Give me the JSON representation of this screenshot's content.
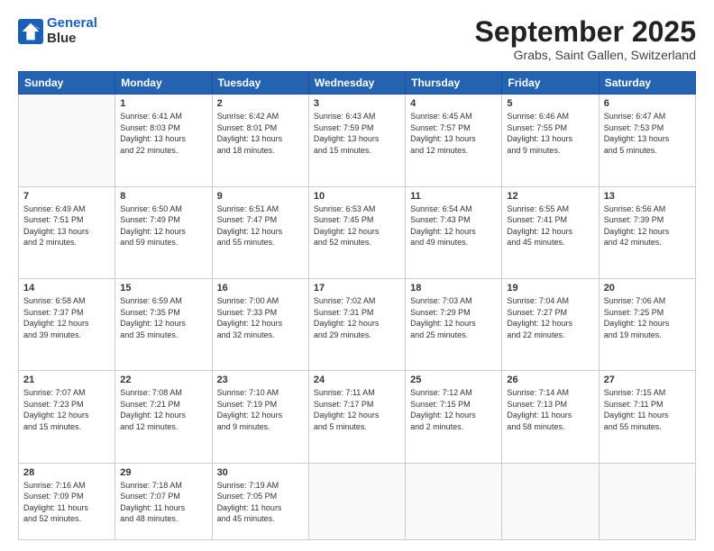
{
  "logo": {
    "line1": "General",
    "line2": "Blue"
  },
  "title": "September 2025",
  "location": "Grabs, Saint Gallen, Switzerland",
  "days_header": [
    "Sunday",
    "Monday",
    "Tuesday",
    "Wednesday",
    "Thursday",
    "Friday",
    "Saturday"
  ],
  "weeks": [
    [
      {
        "day": "",
        "content": ""
      },
      {
        "day": "1",
        "content": "Sunrise: 6:41 AM\nSunset: 8:03 PM\nDaylight: 13 hours\nand 22 minutes."
      },
      {
        "day": "2",
        "content": "Sunrise: 6:42 AM\nSunset: 8:01 PM\nDaylight: 13 hours\nand 18 minutes."
      },
      {
        "day": "3",
        "content": "Sunrise: 6:43 AM\nSunset: 7:59 PM\nDaylight: 13 hours\nand 15 minutes."
      },
      {
        "day": "4",
        "content": "Sunrise: 6:45 AM\nSunset: 7:57 PM\nDaylight: 13 hours\nand 12 minutes."
      },
      {
        "day": "5",
        "content": "Sunrise: 6:46 AM\nSunset: 7:55 PM\nDaylight: 13 hours\nand 9 minutes."
      },
      {
        "day": "6",
        "content": "Sunrise: 6:47 AM\nSunset: 7:53 PM\nDaylight: 13 hours\nand 5 minutes."
      }
    ],
    [
      {
        "day": "7",
        "content": "Sunrise: 6:49 AM\nSunset: 7:51 PM\nDaylight: 13 hours\nand 2 minutes."
      },
      {
        "day": "8",
        "content": "Sunrise: 6:50 AM\nSunset: 7:49 PM\nDaylight: 12 hours\nand 59 minutes."
      },
      {
        "day": "9",
        "content": "Sunrise: 6:51 AM\nSunset: 7:47 PM\nDaylight: 12 hours\nand 55 minutes."
      },
      {
        "day": "10",
        "content": "Sunrise: 6:53 AM\nSunset: 7:45 PM\nDaylight: 12 hours\nand 52 minutes."
      },
      {
        "day": "11",
        "content": "Sunrise: 6:54 AM\nSunset: 7:43 PM\nDaylight: 12 hours\nand 49 minutes."
      },
      {
        "day": "12",
        "content": "Sunrise: 6:55 AM\nSunset: 7:41 PM\nDaylight: 12 hours\nand 45 minutes."
      },
      {
        "day": "13",
        "content": "Sunrise: 6:56 AM\nSunset: 7:39 PM\nDaylight: 12 hours\nand 42 minutes."
      }
    ],
    [
      {
        "day": "14",
        "content": "Sunrise: 6:58 AM\nSunset: 7:37 PM\nDaylight: 12 hours\nand 39 minutes."
      },
      {
        "day": "15",
        "content": "Sunrise: 6:59 AM\nSunset: 7:35 PM\nDaylight: 12 hours\nand 35 minutes."
      },
      {
        "day": "16",
        "content": "Sunrise: 7:00 AM\nSunset: 7:33 PM\nDaylight: 12 hours\nand 32 minutes."
      },
      {
        "day": "17",
        "content": "Sunrise: 7:02 AM\nSunset: 7:31 PM\nDaylight: 12 hours\nand 29 minutes."
      },
      {
        "day": "18",
        "content": "Sunrise: 7:03 AM\nSunset: 7:29 PM\nDaylight: 12 hours\nand 25 minutes."
      },
      {
        "day": "19",
        "content": "Sunrise: 7:04 AM\nSunset: 7:27 PM\nDaylight: 12 hours\nand 22 minutes."
      },
      {
        "day": "20",
        "content": "Sunrise: 7:06 AM\nSunset: 7:25 PM\nDaylight: 12 hours\nand 19 minutes."
      }
    ],
    [
      {
        "day": "21",
        "content": "Sunrise: 7:07 AM\nSunset: 7:23 PM\nDaylight: 12 hours\nand 15 minutes."
      },
      {
        "day": "22",
        "content": "Sunrise: 7:08 AM\nSunset: 7:21 PM\nDaylight: 12 hours\nand 12 minutes."
      },
      {
        "day": "23",
        "content": "Sunrise: 7:10 AM\nSunset: 7:19 PM\nDaylight: 12 hours\nand 9 minutes."
      },
      {
        "day": "24",
        "content": "Sunrise: 7:11 AM\nSunset: 7:17 PM\nDaylight: 12 hours\nand 5 minutes."
      },
      {
        "day": "25",
        "content": "Sunrise: 7:12 AM\nSunset: 7:15 PM\nDaylight: 12 hours\nand 2 minutes."
      },
      {
        "day": "26",
        "content": "Sunrise: 7:14 AM\nSunset: 7:13 PM\nDaylight: 11 hours\nand 58 minutes."
      },
      {
        "day": "27",
        "content": "Sunrise: 7:15 AM\nSunset: 7:11 PM\nDaylight: 11 hours\nand 55 minutes."
      }
    ],
    [
      {
        "day": "28",
        "content": "Sunrise: 7:16 AM\nSunset: 7:09 PM\nDaylight: 11 hours\nand 52 minutes."
      },
      {
        "day": "29",
        "content": "Sunrise: 7:18 AM\nSunset: 7:07 PM\nDaylight: 11 hours\nand 48 minutes."
      },
      {
        "day": "30",
        "content": "Sunrise: 7:19 AM\nSunset: 7:05 PM\nDaylight: 11 hours\nand 45 minutes."
      },
      {
        "day": "",
        "content": ""
      },
      {
        "day": "",
        "content": ""
      },
      {
        "day": "",
        "content": ""
      },
      {
        "day": "",
        "content": ""
      }
    ]
  ]
}
